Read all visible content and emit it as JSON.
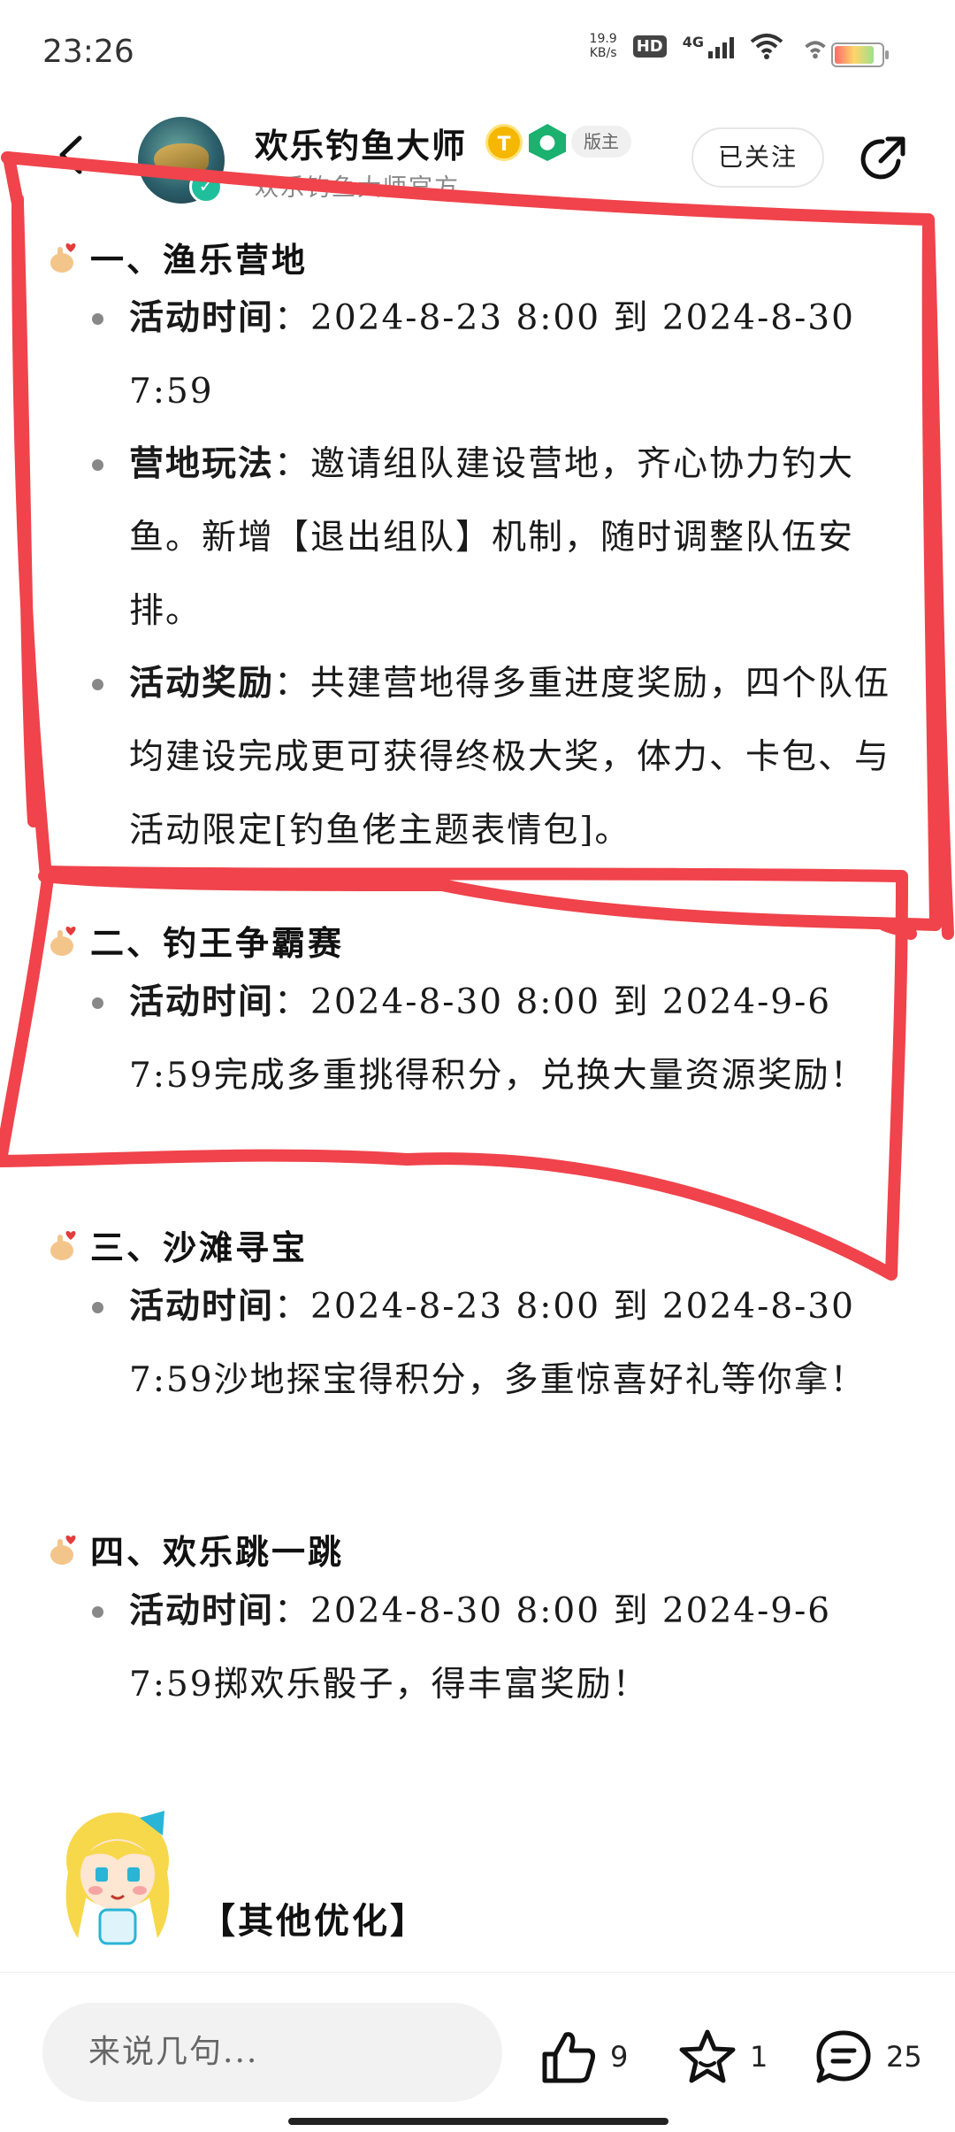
{
  "status_bar": {
    "time": "23:26",
    "net_speed_value": "19.9",
    "net_speed_unit": "KB/s",
    "hd_label": "HD",
    "network_label": "4G"
  },
  "header": {
    "account_name": "欢乐钓鱼大师",
    "account_sub": "欢乐钓鱼大师官方",
    "role_tag": "版主",
    "badge_t": "T",
    "follow_label": "已关注"
  },
  "sections": [
    {
      "title": "一、渔乐营地",
      "items": [
        {
          "label": "活动时间",
          "sep": "：",
          "text": "2024-8-23 8:00 到 2024-8-30 7:59"
        },
        {
          "label": "营地玩法",
          "sep": "：",
          "text": "邀请组队建设营地，齐心协力钓大鱼。新增【退出组队】机制，随时调整队伍安排。"
        },
        {
          "label": "活动奖励",
          "sep": "：",
          "text": "共建营地得多重进度奖励，四个队伍均建设完成更可获得终极大奖，体力、卡包、与活动限定[钓鱼佬主题表情包]。"
        }
      ]
    },
    {
      "title": "二、钓王争霸赛",
      "items": [
        {
          "label": "活动时间",
          "sep": "：",
          "text": "2024-8-30 8:00 到 2024-9-6 7:59完成多重挑得积分，兑换大量资源奖励！"
        }
      ]
    },
    {
      "title": "三、沙滩寻宝",
      "items": [
        {
          "label": "活动时间",
          "sep": "：",
          "text": "2024-8-23 8:00 到 2024-8-30 7:59沙地探宝得积分，多重惊喜好礼等你拿！"
        }
      ]
    },
    {
      "title": "四、欢乐跳一跳",
      "items": [
        {
          "label": "活动时间",
          "sep": "：",
          "text": "2024-8-30 8:00 到 2024-9-6 7:59掷欢乐骰子，得丰富奖励！"
        }
      ]
    }
  ],
  "other_optimizations": "【其他优化】",
  "bottom_bar": {
    "comment_placeholder": "来说几句...",
    "like_count": "9",
    "star_count": "1",
    "comment_count": "25"
  },
  "colors": {
    "annotation_red": "#f0434b",
    "verified_green": "#1fbf9c",
    "badge_gold": "#f5b700",
    "badge_group_green": "#1bb16f"
  },
  "icons": [
    "back-arrow-icon",
    "share-icon",
    "hand-heart-icon",
    "like-icon",
    "star-icon",
    "comment-icon",
    "wifi-icon",
    "signal-icon",
    "battery-icon"
  ]
}
